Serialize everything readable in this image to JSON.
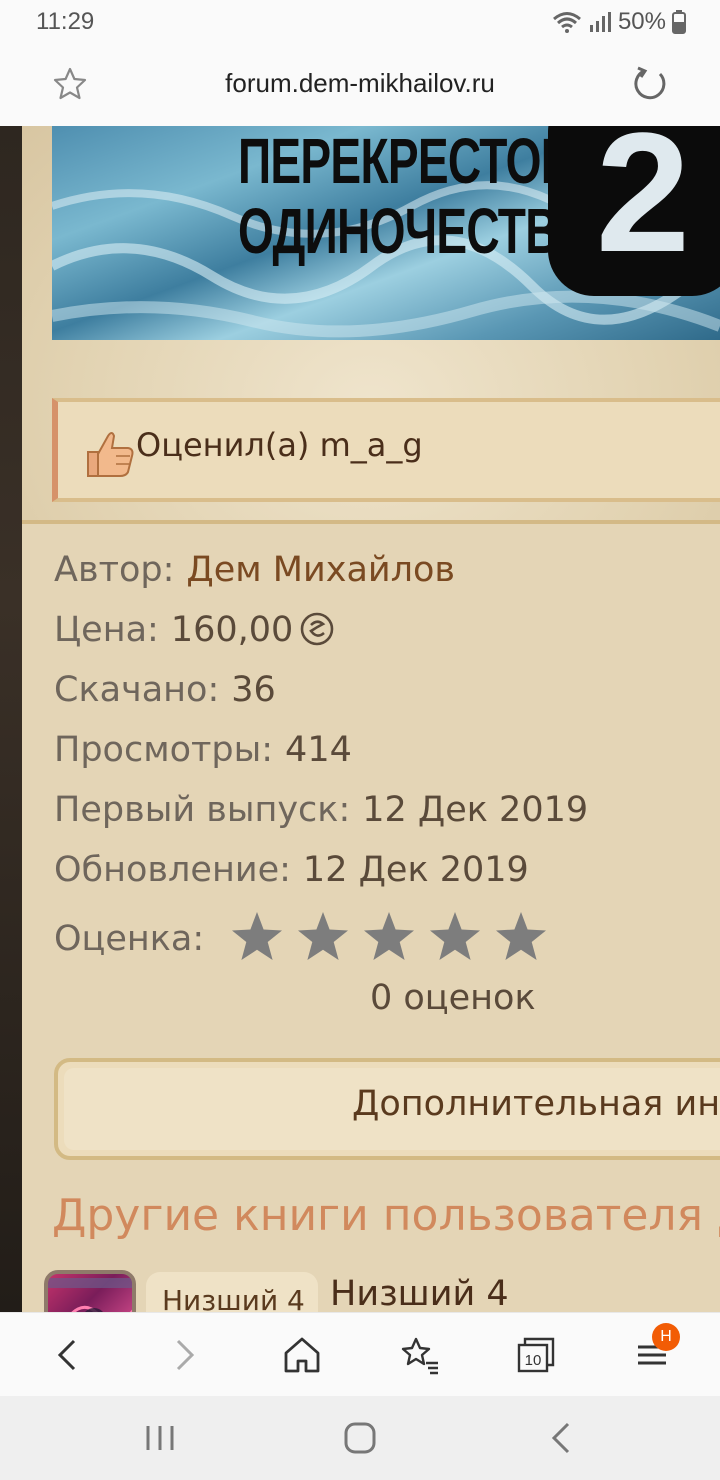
{
  "status_bar": {
    "time": "11:29",
    "battery": "50%",
    "icons": [
      "wifi-icon",
      "signal-icon",
      "battery-icon"
    ]
  },
  "url_bar": {
    "url": "forum.dem-mikhailov.ru",
    "icons": [
      "star-outline-icon",
      "reload-icon"
    ]
  },
  "cover": {
    "title_line1": "ПЕРЕКРЕСТОК",
    "title_line2": "ОДИНОЧЕСТВА",
    "number": "2"
  },
  "liked": {
    "text": "Оценил(а) m_a_g",
    "icon": "thumbs-up-icon"
  },
  "info": {
    "author_label": "Автор:",
    "author_value": "Дем Михайлов",
    "price_label": "Цена:",
    "price_value": "160,00",
    "downloaded_label": "Скачано:",
    "downloaded_value": "36",
    "views_label": "Просмотры:",
    "views_value": "414",
    "first_release_label": "Первый выпуск:",
    "first_release_value": "12 Дек 2019",
    "update_label": "Обновление:",
    "update_value": "12 Дек 2019",
    "rating_label": "Оценка:",
    "rating_value": 0,
    "rating_max": 5,
    "ratings_count": "0 оценок"
  },
  "more_info": {
    "label": "Дополнительная инф"
  },
  "other_books": {
    "title": "Другие книги пользователя Д",
    "items": [
      {
        "chip": "Низший 4",
        "title": "Низший 4"
      }
    ]
  },
  "colors": {
    "panel": "#e4d5b6",
    "accent": "#d1895d",
    "author": "#7a4a22",
    "star_empty": "#7d7d7d",
    "badge": "#f25c05"
  },
  "browser_toolbar": {
    "tabs_count": "10",
    "menu_badge": "H",
    "icons": [
      "back-arrow-icon",
      "forward-arrow-icon",
      "home-icon",
      "bookmarks-icon",
      "tabs-icon",
      "menu-icon"
    ]
  },
  "nav_bar": {
    "icons": [
      "recent-apps-icon",
      "home-button-icon",
      "back-icon"
    ]
  }
}
